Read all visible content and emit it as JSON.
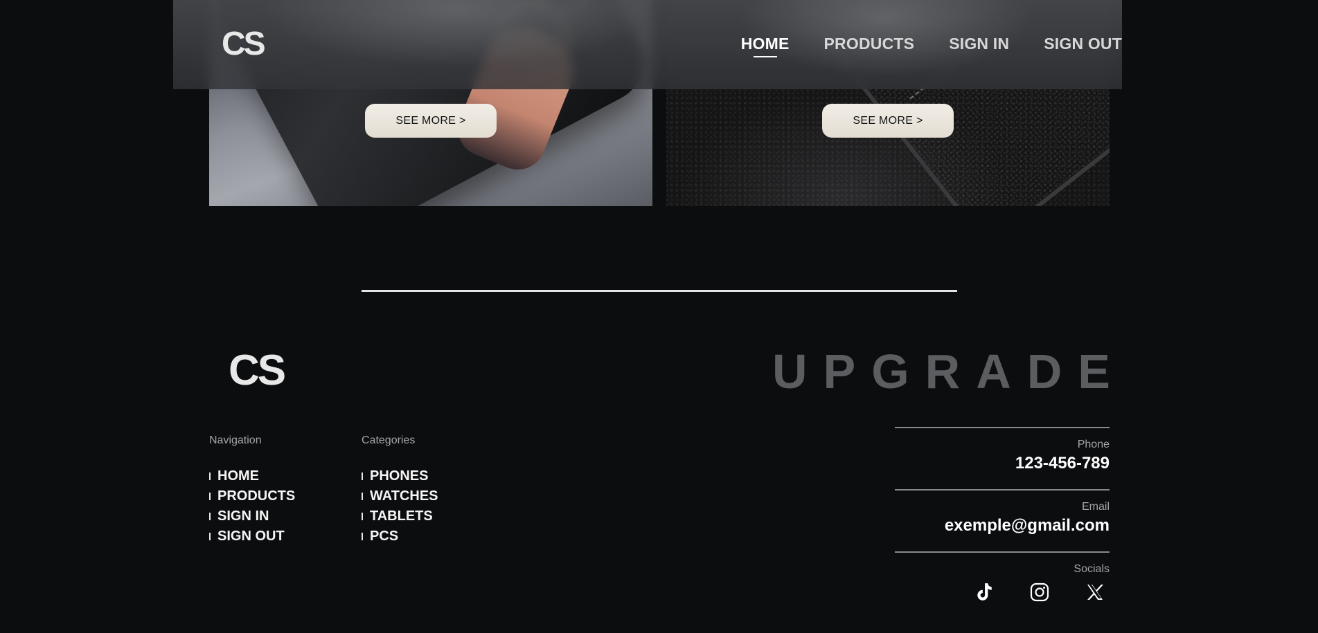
{
  "header": {
    "logo": "CS",
    "nav": [
      {
        "label": "HOME",
        "active": true
      },
      {
        "label": "PRODUCTS",
        "active": false
      },
      {
        "label": "SIGN IN",
        "active": false
      },
      {
        "label": "SIGN OUT",
        "active": false
      }
    ]
  },
  "cards": [
    {
      "button_label": "SEE MORE >"
    },
    {
      "button_label": "SEE MORE >"
    }
  ],
  "footer": {
    "logo": "CS",
    "tagline": "UPGRADE",
    "navigation": {
      "title": "Navigation",
      "items": [
        "HOME",
        "PRODUCTS",
        "SIGN IN",
        "SIGN OUT"
      ]
    },
    "categories": {
      "title": "Categories",
      "items": [
        "PHONES",
        "WATCHES",
        "TABLETS",
        "PCS"
      ]
    },
    "contact": {
      "phone_label": "Phone",
      "phone": "123-456-789",
      "email_label": "Email",
      "email": "exemple@gmail.com",
      "socials_label": "Socials"
    },
    "socials": [
      {
        "icon": "tiktok-icon"
      },
      {
        "icon": "instagram-icon"
      },
      {
        "icon": "x-icon"
      }
    ]
  },
  "colors": {
    "background": "#0c0d0f",
    "button": "#ece7df",
    "tagline": "#5c5d60"
  }
}
